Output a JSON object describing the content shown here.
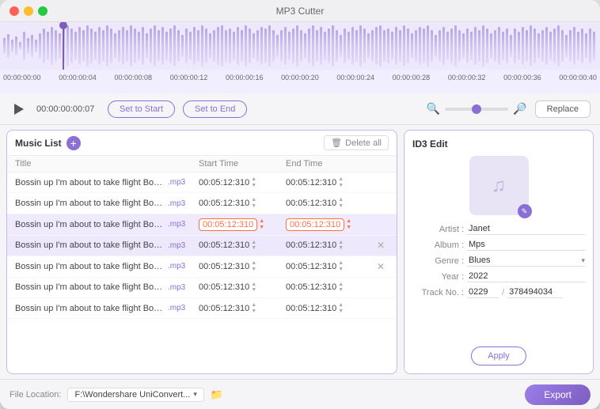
{
  "window": {
    "title": "MP3 Cutter"
  },
  "timeline": {
    "markers": [
      "00:00:00:00",
      "00:00:00:04",
      "00:00:00:08",
      "00:00:00:12",
      "00:00:00:16",
      "00:00:00:20",
      "00:00:00:24",
      "00:00:00:28",
      "00:00:00:32",
      "00:00:00:36",
      "00:00:00:40"
    ]
  },
  "controls": {
    "time_display": "00:00:00:00:07",
    "set_to_start": "Set to Start",
    "set_to_end": "Set to End",
    "replace": "Replace"
  },
  "music_panel": {
    "title": "Music List",
    "delete_all": "Delete all",
    "columns": {
      "title": "Title",
      "start_time": "Start Time",
      "end_time": "End Time"
    },
    "rows": [
      {
        "name": "Bossin up I'm about to take flight Bossin up I'm a...",
        "ext": ".mp3",
        "start": "00:05:12:310",
        "end": "00:05:12:310",
        "highlighted": false,
        "deletable": false
      },
      {
        "name": "Bossin up I'm about to take flight Bossin up I'm a...",
        "ext": ".mp3",
        "start": "00:05:12:310",
        "end": "00:05:12:310",
        "highlighted": false,
        "deletable": false
      },
      {
        "name": "Bossin up I'm about to take flight Bossin up I'm a...",
        "ext": ".mp3",
        "start": "00:05:12:310",
        "end": "00:05:12:310",
        "highlighted": true,
        "deletable": false
      },
      {
        "name": "Bossin up I'm about to take flight Bossin up I'm a...",
        "ext": ".mp3",
        "start": "00:05:12:310",
        "end": "00:05:12:310",
        "highlighted": false,
        "deletable": true,
        "selected": true
      },
      {
        "name": "Bossin up I'm about to take flight Bossin up I'm a...",
        "ext": ".mp3",
        "start": "00:05:12:310",
        "end": "00:05:12:310",
        "highlighted": false,
        "deletable": true
      },
      {
        "name": "Bossin up I'm about to take flight Bossin up I'm a...",
        "ext": ".mp3",
        "start": "00:05:12:310",
        "end": "00:05:12:310",
        "highlighted": false,
        "deletable": false
      },
      {
        "name": "Bossin up I'm about to take flight Bossin up I'm a...",
        "ext": ".mp3",
        "start": "00:05:12:310",
        "end": "00:05:12:310",
        "highlighted": false,
        "deletable": false
      }
    ]
  },
  "id3_panel": {
    "title": "ID3 Edit",
    "fields": {
      "artist_label": "Artist :",
      "artist_value": "Janet",
      "album_label": "Album :",
      "album_value": "Mps",
      "genre_label": "Genre :",
      "genre_value": "Blues",
      "year_label": "Year :",
      "year_value": "2022",
      "track_label": "Track No. :",
      "track_value": "0229",
      "track_total": "378494034"
    },
    "apply_btn": "Apply"
  },
  "bottom_bar": {
    "file_location_label": "File Location:",
    "file_path": "F:\\Wondershare UniConvert...",
    "export_btn": "Export"
  }
}
